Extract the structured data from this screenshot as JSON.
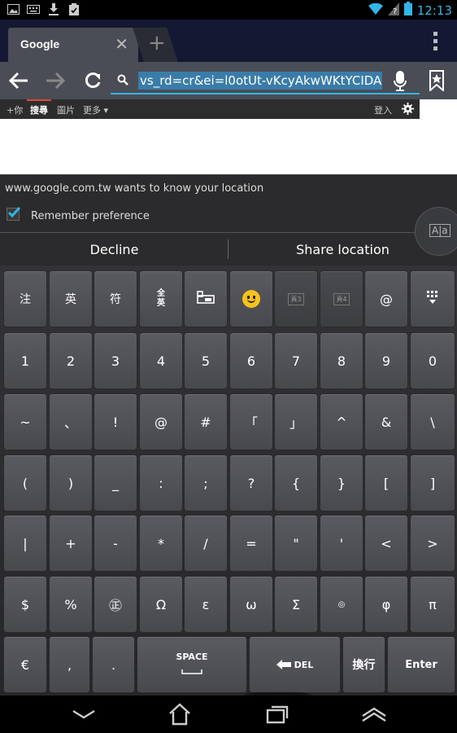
{
  "status_bar": {
    "time": "12:13",
    "left_icons": [
      "image-icon",
      "keyboard-icon",
      "download-icon",
      "clipboard-check-icon"
    ],
    "right_icons": [
      "wifi-icon",
      "signal-icon",
      "battery-icon"
    ]
  },
  "tab": {
    "title": "Google"
  },
  "toolbar": {
    "url_text": "vs_rd=cr&ei=l0otUt-vKcyAkwWKtYCIDA"
  },
  "google_bar": {
    "items": [
      "+你",
      "搜尋",
      "圖片",
      "更多 ▾"
    ],
    "signin": "登入"
  },
  "prompt": {
    "message": "www.google.com.tw wants to know your location",
    "remember_label": "Remember preference",
    "remember_checked": true,
    "decline_label": "Decline",
    "share_label": "Share location"
  },
  "keyboard": {
    "row1": [
      "注",
      "英",
      "符",
      "全英",
      "layout",
      "smiley",
      "頁3",
      "頁4",
      "@",
      "grid"
    ],
    "row2": [
      "1",
      "2",
      "3",
      "4",
      "5",
      "6",
      "7",
      "8",
      "9",
      "0"
    ],
    "row3": [
      "~",
      "、",
      "!",
      "@",
      "#",
      "「",
      "」",
      "^",
      "&",
      "\\"
    ],
    "row4": [
      "(",
      ")",
      "_",
      ":",
      ";",
      "?",
      "{",
      "}",
      "[",
      "]"
    ],
    "row5": [
      "|",
      "+",
      "-",
      "*",
      "/",
      "=",
      "\"",
      "'",
      "<",
      ">"
    ],
    "row6": [
      "$",
      "%",
      "㊣",
      "Ω",
      "ε",
      "ω",
      "Σ",
      "◎",
      "φ",
      "π"
    ],
    "row7": {
      "euro": "€",
      "comma": ",",
      "period": ".",
      "space": "SPACE",
      "del": "DEL",
      "newline": "換行",
      "enter": "Enter"
    }
  },
  "colors": {
    "accent": "#33b5e5",
    "url_select": "#3a7ca8"
  }
}
